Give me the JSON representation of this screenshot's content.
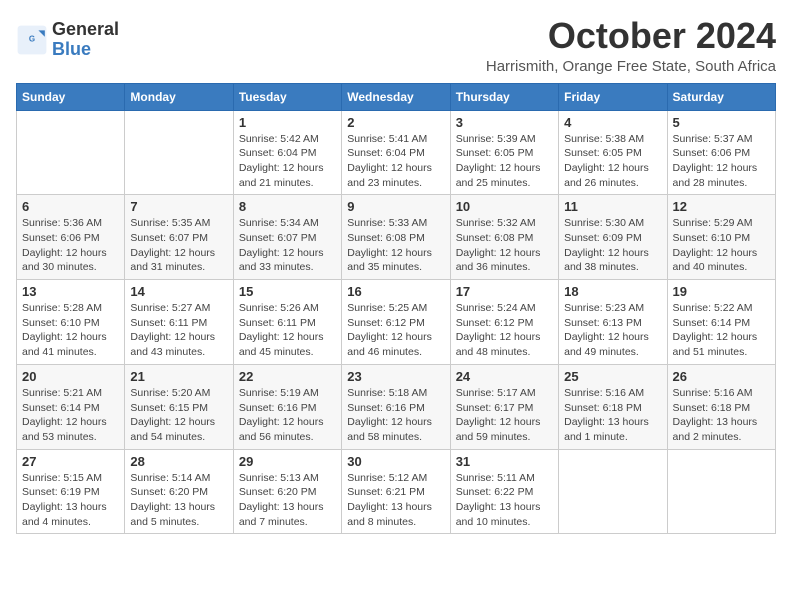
{
  "logo": {
    "line1": "General",
    "line2": "Blue"
  },
  "header": {
    "month": "October 2024",
    "location": "Harrismith, Orange Free State, South Africa"
  },
  "weekdays": [
    "Sunday",
    "Monday",
    "Tuesday",
    "Wednesday",
    "Thursday",
    "Friday",
    "Saturday"
  ],
  "weeks": [
    [
      {
        "day": "",
        "info": ""
      },
      {
        "day": "",
        "info": ""
      },
      {
        "day": "1",
        "info": "Sunrise: 5:42 AM\nSunset: 6:04 PM\nDaylight: 12 hours and 21 minutes."
      },
      {
        "day": "2",
        "info": "Sunrise: 5:41 AM\nSunset: 6:04 PM\nDaylight: 12 hours and 23 minutes."
      },
      {
        "day": "3",
        "info": "Sunrise: 5:39 AM\nSunset: 6:05 PM\nDaylight: 12 hours and 25 minutes."
      },
      {
        "day": "4",
        "info": "Sunrise: 5:38 AM\nSunset: 6:05 PM\nDaylight: 12 hours and 26 minutes."
      },
      {
        "day": "5",
        "info": "Sunrise: 5:37 AM\nSunset: 6:06 PM\nDaylight: 12 hours and 28 minutes."
      }
    ],
    [
      {
        "day": "6",
        "info": "Sunrise: 5:36 AM\nSunset: 6:06 PM\nDaylight: 12 hours and 30 minutes."
      },
      {
        "day": "7",
        "info": "Sunrise: 5:35 AM\nSunset: 6:07 PM\nDaylight: 12 hours and 31 minutes."
      },
      {
        "day": "8",
        "info": "Sunrise: 5:34 AM\nSunset: 6:07 PM\nDaylight: 12 hours and 33 minutes."
      },
      {
        "day": "9",
        "info": "Sunrise: 5:33 AM\nSunset: 6:08 PM\nDaylight: 12 hours and 35 minutes."
      },
      {
        "day": "10",
        "info": "Sunrise: 5:32 AM\nSunset: 6:08 PM\nDaylight: 12 hours and 36 minutes."
      },
      {
        "day": "11",
        "info": "Sunrise: 5:30 AM\nSunset: 6:09 PM\nDaylight: 12 hours and 38 minutes."
      },
      {
        "day": "12",
        "info": "Sunrise: 5:29 AM\nSunset: 6:10 PM\nDaylight: 12 hours and 40 minutes."
      }
    ],
    [
      {
        "day": "13",
        "info": "Sunrise: 5:28 AM\nSunset: 6:10 PM\nDaylight: 12 hours and 41 minutes."
      },
      {
        "day": "14",
        "info": "Sunrise: 5:27 AM\nSunset: 6:11 PM\nDaylight: 12 hours and 43 minutes."
      },
      {
        "day": "15",
        "info": "Sunrise: 5:26 AM\nSunset: 6:11 PM\nDaylight: 12 hours and 45 minutes."
      },
      {
        "day": "16",
        "info": "Sunrise: 5:25 AM\nSunset: 6:12 PM\nDaylight: 12 hours and 46 minutes."
      },
      {
        "day": "17",
        "info": "Sunrise: 5:24 AM\nSunset: 6:12 PM\nDaylight: 12 hours and 48 minutes."
      },
      {
        "day": "18",
        "info": "Sunrise: 5:23 AM\nSunset: 6:13 PM\nDaylight: 12 hours and 49 minutes."
      },
      {
        "day": "19",
        "info": "Sunrise: 5:22 AM\nSunset: 6:14 PM\nDaylight: 12 hours and 51 minutes."
      }
    ],
    [
      {
        "day": "20",
        "info": "Sunrise: 5:21 AM\nSunset: 6:14 PM\nDaylight: 12 hours and 53 minutes."
      },
      {
        "day": "21",
        "info": "Sunrise: 5:20 AM\nSunset: 6:15 PM\nDaylight: 12 hours and 54 minutes."
      },
      {
        "day": "22",
        "info": "Sunrise: 5:19 AM\nSunset: 6:16 PM\nDaylight: 12 hours and 56 minutes."
      },
      {
        "day": "23",
        "info": "Sunrise: 5:18 AM\nSunset: 6:16 PM\nDaylight: 12 hours and 58 minutes."
      },
      {
        "day": "24",
        "info": "Sunrise: 5:17 AM\nSunset: 6:17 PM\nDaylight: 12 hours and 59 minutes."
      },
      {
        "day": "25",
        "info": "Sunrise: 5:16 AM\nSunset: 6:18 PM\nDaylight: 13 hours and 1 minute."
      },
      {
        "day": "26",
        "info": "Sunrise: 5:16 AM\nSunset: 6:18 PM\nDaylight: 13 hours and 2 minutes."
      }
    ],
    [
      {
        "day": "27",
        "info": "Sunrise: 5:15 AM\nSunset: 6:19 PM\nDaylight: 13 hours and 4 minutes."
      },
      {
        "day": "28",
        "info": "Sunrise: 5:14 AM\nSunset: 6:20 PM\nDaylight: 13 hours and 5 minutes."
      },
      {
        "day": "29",
        "info": "Sunrise: 5:13 AM\nSunset: 6:20 PM\nDaylight: 13 hours and 7 minutes."
      },
      {
        "day": "30",
        "info": "Sunrise: 5:12 AM\nSunset: 6:21 PM\nDaylight: 13 hours and 8 minutes."
      },
      {
        "day": "31",
        "info": "Sunrise: 5:11 AM\nSunset: 6:22 PM\nDaylight: 13 hours and 10 minutes."
      },
      {
        "day": "",
        "info": ""
      },
      {
        "day": "",
        "info": ""
      }
    ]
  ]
}
